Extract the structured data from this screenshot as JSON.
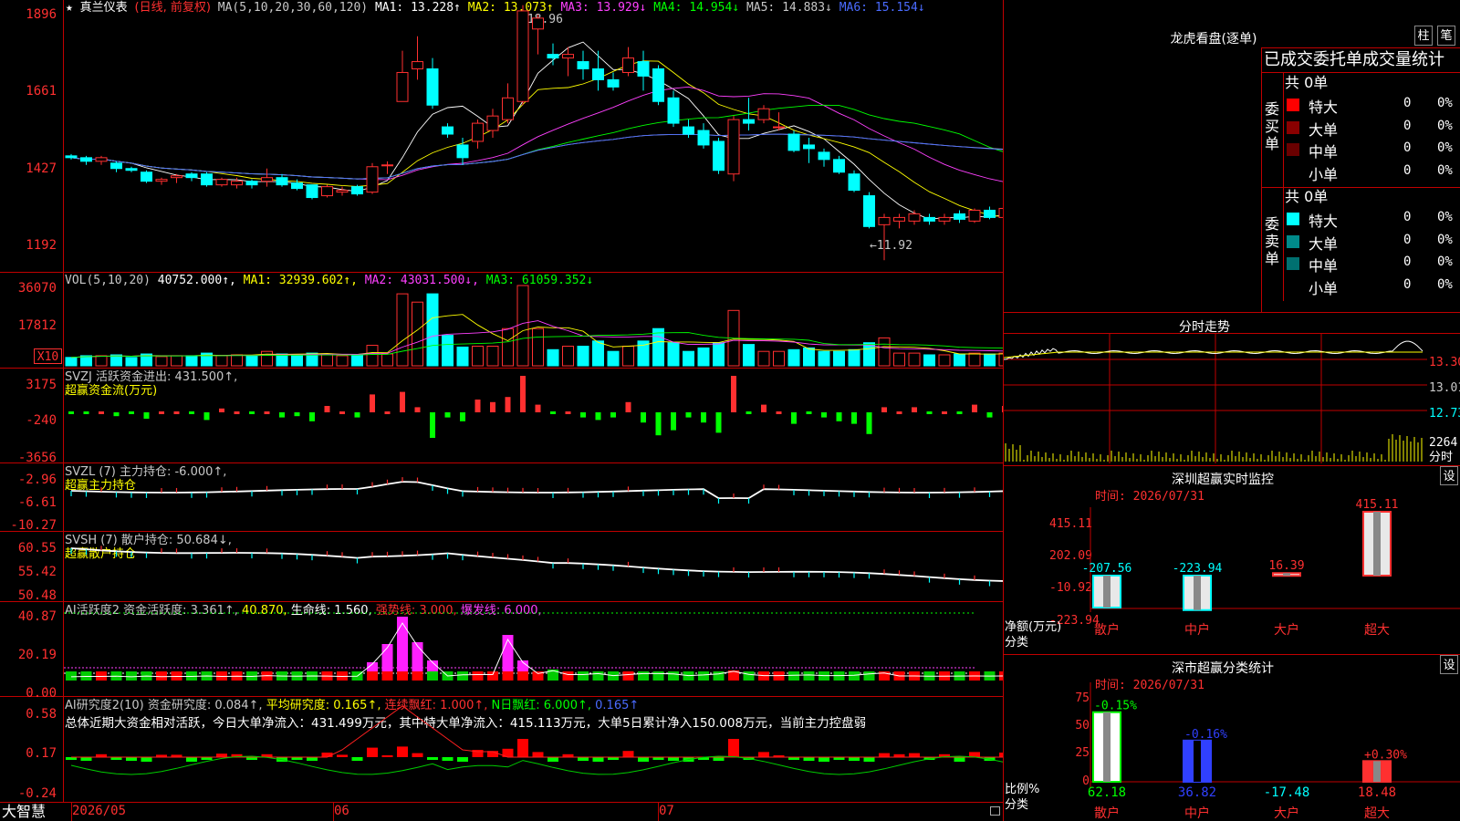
{
  "main": {
    "title": "真兰仪表",
    "period": "(日线, 前复权)",
    "ma_label": "MA(5,10,20,30,60,120)",
    "ma": [
      {
        "label": "MA1: 13.228↑",
        "color": "#ffffff"
      },
      {
        "label": "MA2: 13.073↑",
        "color": "#ffff00"
      },
      {
        "label": "MA3: 13.929↓",
        "color": "#ff40ff"
      },
      {
        "label": "MA4: 14.954↓",
        "color": "#00ff00"
      },
      {
        "label": "MA5: 14.883↓",
        "color": "#c8c8c8"
      },
      {
        "label": "MA6: 15.154↓",
        "color": "#4a6bff"
      }
    ],
    "y_ticks": [
      "1896",
      "1661",
      "1427",
      "1192"
    ],
    "high_label": "18.96",
    "low_label": "←11.92"
  },
  "vol": {
    "label": "VOL(5,10,20)",
    "value": "40752.000↑,",
    "ma1": "MA1: 32939.602↑,",
    "ma2": "MA2: 43031.500↓,",
    "ma3": "MA3: 61059.352↓",
    "y_ticks": [
      "36070",
      "17812"
    ],
    "unit": "X10"
  },
  "svzj": {
    "label": "SVZJ  活跃资金进出: 431.500↑,",
    "sub": "超赢资金流(万元)",
    "y_ticks": [
      "3175",
      "-240",
      "-3656"
    ]
  },
  "svzl": {
    "label": "SVZL  (7) 主力持仓: -6.000↑,",
    "sub": "超赢主力持仓",
    "y_ticks": [
      "-2.96",
      "-6.61",
      "-10.27"
    ]
  },
  "svsh": {
    "label": "SVSH  (7) 散户持仓: 50.684↓,",
    "sub": "超赢散户持仓",
    "y_ticks": [
      "60.55",
      "55.42",
      "50.48"
    ]
  },
  "ai_active": {
    "label": "AI活跃度2 资金活跃度: 3.361↑,",
    "v2": "40.870,",
    "v3": "生命线: 1.560,",
    "v4": "强势线: 3.000,",
    "v5": "爆发线: 6.000,",
    "y_ticks": [
      "40.87",
      "20.19",
      "0.00"
    ]
  },
  "ai_research": {
    "label": "AI研究度2(10) 资金研究度: 0.084↑,",
    "v2": "平均研究度: 0.165↑,",
    "v3": "连续飘红: 1.000↑,",
    "v4": "N日飘红: 6.000↑,",
    "v5": "0.165↑",
    "summary": "总体近期大资金相对活跃，今日大单净流入：431.499万元，其中特大单净流入：415.113万元，大单5日累计净入150.008万元，当前主力控盘弱",
    "y_ticks": [
      "0.58",
      "0.17",
      "-0.24"
    ]
  },
  "bottom": {
    "logo": "大智慧",
    "dates": [
      "2026/05",
      "06",
      "07"
    ]
  },
  "right": {
    "lhb_title": "龙虎看盘(逐单)",
    "btn_zhu": "柱",
    "btn_bi": "笔",
    "order_header": "已成交委托单成交量统计",
    "buy": {
      "total": "共 0单",
      "side": "委买单",
      "rows": [
        {
          "label": "特大",
          "count": "0",
          "pct": "0%",
          "color": "#ff0000"
        },
        {
          "label": "大单",
          "count": "0",
          "pct": "0%",
          "color": "#8a0000"
        },
        {
          "label": "中单",
          "count": "0",
          "pct": "0%",
          "color": "#6a0000"
        },
        {
          "label": "小单",
          "count": "0",
          "pct": "0%",
          "color": "#000000"
        }
      ]
    },
    "sell": {
      "total": "共 0单",
      "side": "委卖单",
      "rows": [
        {
          "label": "特大",
          "count": "0",
          "pct": "0%",
          "color": "#00ffff"
        },
        {
          "label": "大单",
          "count": "0",
          "pct": "0%",
          "color": "#008a8a"
        },
        {
          "label": "中单",
          "count": "0",
          "pct": "0%",
          "color": "#007070"
        },
        {
          "label": "小单",
          "count": "0",
          "pct": "0%",
          "color": "#000000"
        }
      ]
    },
    "intraday_title": "分时走势",
    "intraday_ticks": [
      "13.30",
      "13.01",
      "12.73"
    ],
    "intraday_vol": "2264",
    "intraday_lbl": "分时",
    "sz_title": "深圳超赢实时监控",
    "sz_btn": "设",
    "sz_time": "时间: 2026/07/31",
    "sz_ticks": [
      "415.11",
      "202.09",
      "-10.92",
      "-223.94"
    ],
    "sz_ylabel": "净额(万元)",
    "sz_xlabel": "分类",
    "sz_bars": [
      {
        "cat": "散户",
        "value": -207.56,
        "label": "-207.56"
      },
      {
        "cat": "中户",
        "value": -223.94,
        "label": "-223.94"
      },
      {
        "cat": "大户",
        "value": 16.39,
        "label": "16.39"
      },
      {
        "cat": "超大",
        "value": 415.11,
        "label": "415.11"
      }
    ],
    "cls_title": "深市超赢分类统计",
    "cls_btn": "设",
    "cls_time": "时间: 2026/07/31",
    "cls_ticks": [
      "75",
      "50",
      "25",
      "0"
    ],
    "cls_ylabel": "比例%",
    "cls_xlabel": "分类",
    "cls_bars": [
      {
        "cat": "散户",
        "value": 62.18,
        "label": "62.18",
        "top": "-0.15%",
        "color": "#ffffff"
      },
      {
        "cat": "中户",
        "value": 36.82,
        "label": "36.82",
        "top": "-0.16%",
        "color": "#3040ff"
      },
      {
        "cat": "大户",
        "value": -17.48,
        "label": "-17.48",
        "top": "",
        "color": "#ffffff"
      },
      {
        "cat": "超大",
        "value": 18.48,
        "label": "18.48",
        "top": "+0.30%",
        "color": "#ff3030"
      }
    ]
  },
  "chart_data": {
    "type": "candlestick",
    "title": "真兰仪表",
    "ylim": [
      11.92,
      18.96
    ],
    "candles": [
      [
        14.8,
        14.85,
        14.7,
        14.75
      ],
      [
        14.75,
        14.8,
        14.55,
        14.65
      ],
      [
        14.65,
        14.8,
        14.55,
        14.75
      ],
      [
        14.6,
        14.65,
        14.35,
        14.45
      ],
      [
        14.45,
        14.5,
        14.35,
        14.4
      ],
      [
        14.35,
        14.4,
        14.05,
        14.1
      ],
      [
        14.1,
        14.2,
        14.0,
        14.15
      ],
      [
        14.2,
        14.3,
        14.05,
        14.25
      ],
      [
        14.3,
        14.35,
        14.1,
        14.2
      ],
      [
        14.3,
        14.35,
        13.95,
        14.0
      ],
      [
        14.0,
        14.2,
        13.95,
        14.15
      ],
      [
        14.0,
        14.2,
        13.9,
        14.1
      ],
      [
        14.1,
        14.15,
        13.9,
        14.0
      ],
      [
        14.1,
        14.45,
        13.95,
        14.2
      ],
      [
        14.2,
        14.3,
        13.95,
        14.0
      ],
      [
        14.05,
        14.15,
        13.85,
        13.9
      ],
      [
        14.0,
        14.0,
        13.6,
        13.65
      ],
      [
        13.7,
        14.0,
        13.65,
        13.95
      ],
      [
        13.8,
        13.95,
        13.7,
        13.85
      ],
      [
        13.95,
        14.0,
        13.7,
        13.75
      ],
      [
        13.8,
        14.6,
        13.75,
        14.5
      ],
      [
        14.55,
        14.65,
        14.3,
        14.55
      ],
      [
        16.3,
        17.7,
        16.3,
        17.1
      ],
      [
        17.2,
        18.1,
        16.9,
        17.4
      ],
      [
        17.2,
        17.5,
        16.1,
        16.2
      ],
      [
        15.6,
        15.7,
        15.3,
        15.4
      ],
      [
        15.1,
        15.3,
        14.55,
        14.75
      ],
      [
        15.2,
        15.8,
        15.0,
        15.7
      ],
      [
        15.5,
        16.1,
        15.3,
        15.9
      ],
      [
        15.8,
        16.8,
        15.7,
        16.4
      ],
      [
        16.3,
        18.96,
        16.2,
        18.8
      ],
      [
        18.3,
        18.7,
        17.6,
        18.6
      ],
      [
        17.6,
        17.9,
        17.3,
        17.5
      ],
      [
        17.5,
        17.8,
        17.0,
        17.6
      ],
      [
        17.4,
        17.7,
        16.9,
        17.2
      ],
      [
        17.2,
        17.7,
        16.6,
        16.9
      ],
      [
        16.9,
        17.1,
        16.6,
        16.7
      ],
      [
        17.1,
        17.8,
        17.0,
        17.5
      ],
      [
        17.4,
        17.7,
        16.6,
        17.0
      ],
      [
        17.2,
        17.3,
        16.2,
        16.3
      ],
      [
        16.4,
        16.6,
        15.6,
        15.7
      ],
      [
        15.6,
        15.8,
        15.3,
        15.4
      ],
      [
        15.5,
        15.7,
        15.0,
        15.1
      ],
      [
        15.2,
        15.3,
        14.3,
        14.4
      ],
      [
        14.3,
        15.9,
        14.1,
        15.8
      ],
      [
        15.8,
        16.4,
        15.5,
        15.7
      ],
      [
        15.8,
        16.2,
        15.7,
        16.1
      ],
      [
        15.6,
        16.0,
        15.5,
        15.6
      ],
      [
        15.4,
        15.5,
        14.9,
        14.95
      ],
      [
        15.1,
        15.3,
        14.6,
        15.0
      ],
      [
        14.9,
        15.0,
        14.5,
        14.7
      ],
      [
        14.7,
        14.8,
        14.3,
        14.35
      ],
      [
        14.3,
        14.4,
        13.8,
        13.85
      ],
      [
        13.7,
        13.8,
        12.8,
        12.85
      ],
      [
        12.9,
        13.2,
        11.92,
        13.1
      ],
      [
        13.0,
        13.2,
        12.8,
        13.1
      ],
      [
        13.0,
        13.3,
        12.9,
        13.2
      ],
      [
        13.1,
        13.2,
        12.9,
        13.0
      ],
      [
        13.0,
        13.2,
        12.9,
        13.1
      ],
      [
        13.2,
        13.3,
        12.95,
        13.05
      ],
      [
        13.0,
        13.35,
        12.95,
        13.3
      ],
      [
        13.3,
        13.4,
        13.05,
        13.1
      ],
      [
        13.1,
        13.4,
        13.0,
        13.35
      ]
    ]
  }
}
